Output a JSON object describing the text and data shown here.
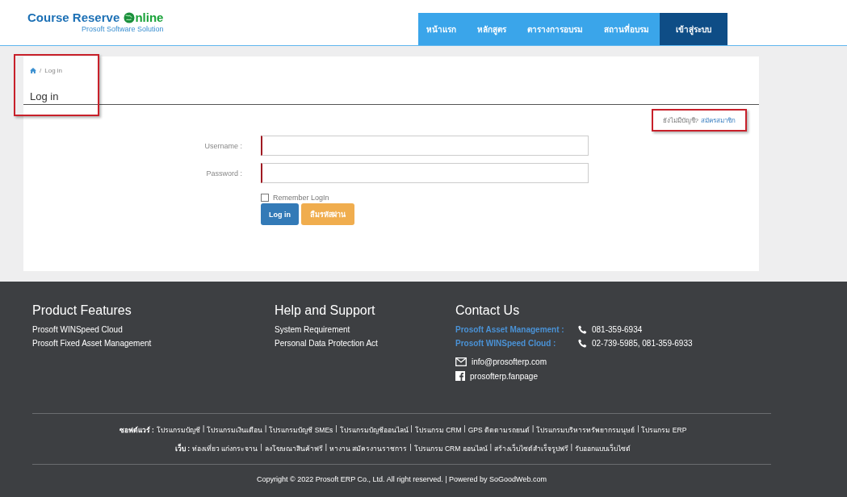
{
  "header": {
    "logo_title_prefix": "Course Reserve ",
    "logo_title_suffix": "nline",
    "logo_subtitle": "Prosoft Software Solution",
    "nav": [
      {
        "label": "หน้าแรก",
        "selected": false
      },
      {
        "label": "หลักสูตร",
        "selected": false
      },
      {
        "label": "ตารางการอบรม",
        "selected": false
      },
      {
        "label": "สถานที่อบรม",
        "selected": false
      },
      {
        "label": "เข้าสู่ระบบ",
        "selected": true
      }
    ]
  },
  "breadcrumb": {
    "separator": "/",
    "current": "Log in"
  },
  "page_title": "Log in",
  "signup": {
    "question": "ยังไม่มีบัญชี?",
    "link": "สมัครสมาชิก"
  },
  "form": {
    "fields": [
      {
        "label": "Username :"
      },
      {
        "label": "Password :"
      }
    ],
    "remember": {
      "label": "Remember LogIn",
      "checked": false
    },
    "buttons": [
      {
        "label": "Log in",
        "kind": "primary"
      },
      {
        "label": "ลืมรหัสผ่าน",
        "kind": "warning"
      }
    ]
  },
  "footer": {
    "columns": [
      {
        "title": "Product Features",
        "links": [
          "Prosoft WINSpeed Cloud",
          "Prosoft Fixed Asset Management"
        ]
      },
      {
        "title": "Help and Support",
        "links": [
          "System Requirement",
          "Personal Data Protection Act"
        ]
      }
    ],
    "contact": {
      "title": "Contact Us",
      "phones": [
        {
          "name": "Prosoft Asset Management :",
          "number": "081-359-6934"
        },
        {
          "name": "Prosoft WINSpeed Cloud :",
          "number": "02-739-5985, 081-359-6933"
        }
      ],
      "email": "info@prosofterp.com",
      "facebook": "prosofterp.fanpage"
    },
    "link_rows": [
      {
        "label": "ซอฟต์แวร์ :",
        "items": [
          {
            "text": "โปรแกรมบัญชี"
          },
          {
            "text": "|"
          },
          {
            "text": "โปรแกรมเงินเดือน"
          },
          {
            "text": "|"
          },
          {
            "text": "โปรแกรมบัญชี SMEs"
          },
          {
            "text": "|"
          },
          {
            "text": "โปรแกรมบัญชีออนไลน์"
          },
          {
            "text": "|"
          },
          {
            "text": "โปรแกรม CRM"
          },
          {
            "text": "|"
          },
          {
            "text": "GPS ติดตามรถยนต์"
          },
          {
            "text": "|"
          },
          {
            "text": "โปรแกรมบริหารทรัพยากรมนุษย์"
          },
          {
            "text": "|"
          },
          {
            "text": "โปรแกรม ERP"
          }
        ]
      },
      {
        "label": "เว็บ :",
        "items": [
          {
            "text": "ท่องเที่ยว แก่งกระจาน"
          },
          {
            "text": "|"
          },
          {
            "text": "ลงโฆษณาสินค้าฟรี"
          },
          {
            "text": "|"
          },
          {
            "text": "หางาน สมัครงานราชการ"
          },
          {
            "text": "|"
          },
          {
            "text": "โปรแกรม CRM ออนไลน์"
          },
          {
            "text": "|"
          },
          {
            "text": "สร้างเว็บไซต์สำเร็จรูปฟรี"
          },
          {
            "text": "|"
          },
          {
            "text": "รับออกแบบเว็บไซต์"
          }
        ]
      }
    ],
    "copyright": "Copyright © 2022 Prosoft ERP Co., Ltd. All right reserved. | Powered by SoGoodWeb.com"
  }
}
